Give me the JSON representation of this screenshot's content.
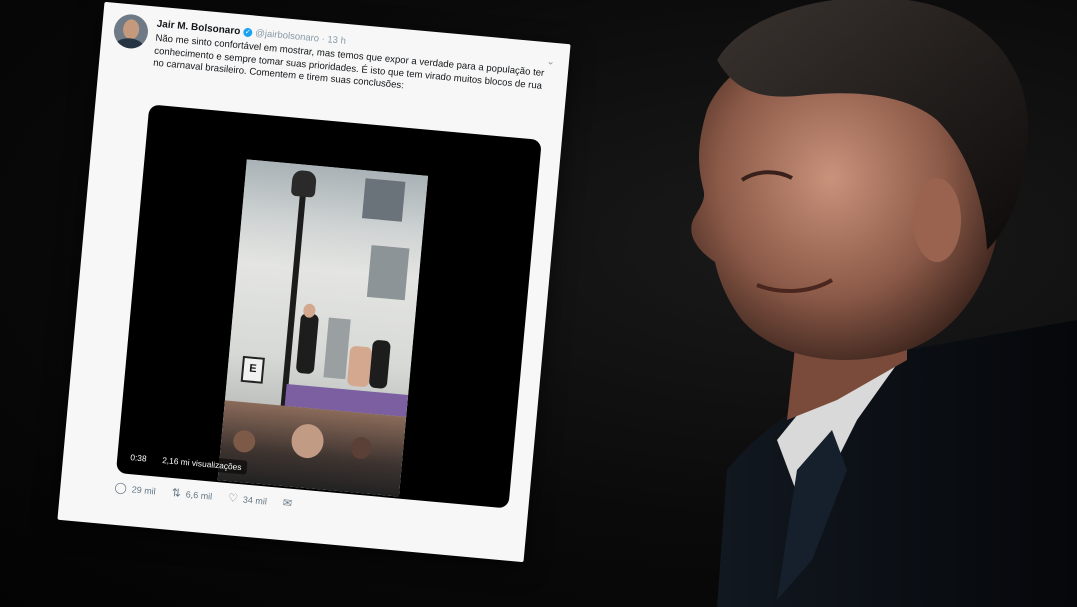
{
  "tweet": {
    "name": "Jair M. Bolsonaro",
    "handle": "@jairbolsonaro · 13 h",
    "text": "Não me sinto confortável em mostrar, mas temos que expor a verdade para a população ter conhecimento e sempre tomar suas prioridades. É isto que tem virado muitos blocos de rua no carnaval brasileiro. Comentem e tirem suas conclusões:",
    "video": {
      "duration": "0:38",
      "views": "2,16 mi visualizações",
      "sign_letter": "E"
    },
    "actions": {
      "replies": "29 mil",
      "retweets": "6,6 mil",
      "likes": "34 mil"
    }
  },
  "icons": [
    "verified-badge-icon",
    "chevron-down-icon",
    "reply-icon",
    "retweet-icon",
    "like-icon",
    "message-icon"
  ]
}
